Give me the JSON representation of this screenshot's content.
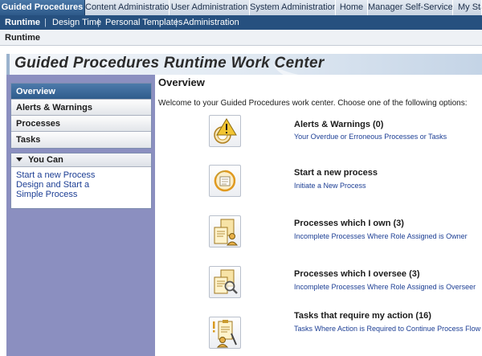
{
  "top_tabs": [
    "Guided Procedures",
    "Content Administration",
    "User Administration",
    "System Administration",
    "Home",
    "Manager Self-Service",
    "My Sta"
  ],
  "sub_nav": [
    "Runtime",
    "Design Time",
    "Personal Templates",
    "Administration"
  ],
  "breadcrumb": "Runtime",
  "banner_title": "Guided Procedures Runtime Work Center",
  "left_nav": {
    "items": [
      "Overview",
      "Alerts & Warnings",
      "Processes",
      "Tasks"
    ],
    "you_can": {
      "heading": "You Can",
      "links": [
        "Start a new Process",
        "Design and Start a Simple Process"
      ]
    }
  },
  "main": {
    "heading": "Overview",
    "intro": "Welcome to your Guided Procedures work center. Choose one of the following options:",
    "options": [
      {
        "title": "Alerts & Warnings (0)",
        "link": "Your Overdue or Erroneous Processes or Tasks",
        "icon": "alerts-gauge-icon"
      },
      {
        "title": "Start a new process",
        "link": "Initiate a New Process",
        "icon": "start-process-icon"
      },
      {
        "title": "Processes which I own (3)",
        "link": "Incomplete Processes Where Role Assigned is Owner",
        "icon": "processes-owned-icon"
      },
      {
        "title": "Processes which I oversee (3)",
        "link": "Incomplete Processes Where Role Assigned is Overseer",
        "icon": "processes-oversee-icon"
      },
      {
        "title": "Tasks that require my action (16)",
        "link": "Tasks Where Action is Required to Continue Process Flow",
        "icon": "tasks-action-icon"
      }
    ]
  },
  "colors": {
    "tab_active": "#2e5a8a",
    "subnav_bg": "#26507f",
    "left_column_bg": "#8b8fc0",
    "link": "#1c3e94",
    "icon_gold": "#e3b23c"
  }
}
